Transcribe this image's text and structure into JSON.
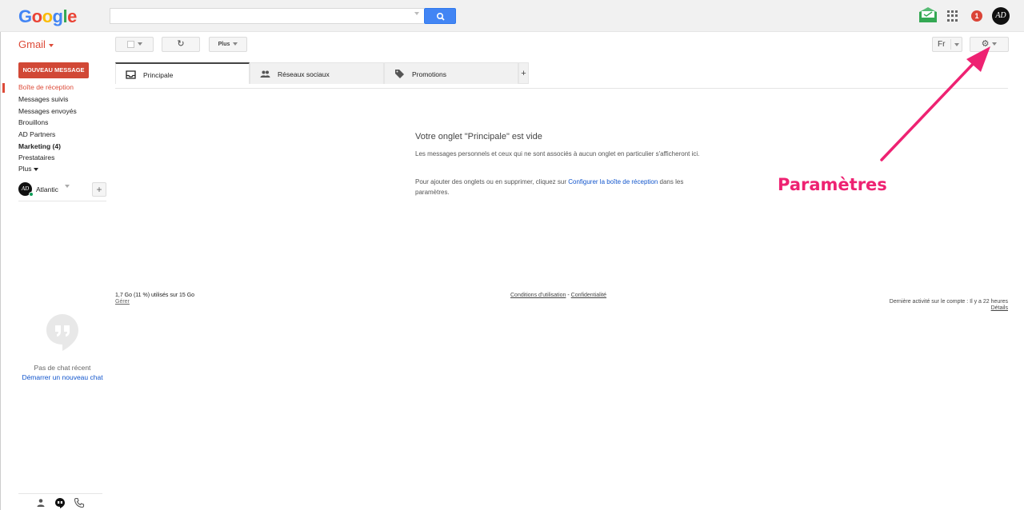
{
  "header": {
    "logo_letters": [
      {
        "ch": "G",
        "color": "#4285f4"
      },
      {
        "ch": "o",
        "color": "#ea4335"
      },
      {
        "ch": "o",
        "color": "#fbbc05"
      },
      {
        "ch": "g",
        "color": "#4285f4"
      },
      {
        "ch": "l",
        "color": "#34a853"
      },
      {
        "ch": "e",
        "color": "#ea4335"
      }
    ],
    "search_value": "",
    "notification_count": "1",
    "avatar_initials": "AD"
  },
  "toolbar": {
    "gmail_label": "Gmail",
    "refresh_glyph": "↻",
    "more_label": "Plus",
    "lang_label": "Fr",
    "settings_glyph": "⚙"
  },
  "sidebar": {
    "compose_label": "NOUVEAU MESSAGE",
    "items": [
      {
        "label": "Boîte de réception",
        "active": true,
        "bold": false
      },
      {
        "label": "Messages suivis",
        "active": false,
        "bold": false
      },
      {
        "label": "Messages envoyés",
        "active": false,
        "bold": false
      },
      {
        "label": "Brouillons",
        "active": false,
        "bold": false
      },
      {
        "label": "AD Partners",
        "active": false,
        "bold": false
      },
      {
        "label": "Marketing (4)",
        "active": false,
        "bold": true
      },
      {
        "label": "Prestataires",
        "active": false,
        "bold": false
      },
      {
        "label": "Plus",
        "active": false,
        "bold": false
      }
    ],
    "account_name": "Atlantic",
    "account_initials": "AD",
    "add_glyph": "+",
    "no_chat": "Pas de chat récent",
    "start_chat": "Démarrer un nouveau chat"
  },
  "tabs": [
    {
      "label": "Principale",
      "icon": "inbox-icon",
      "active": true
    },
    {
      "label": "Réseaux sociaux",
      "icon": "people-icon",
      "active": false
    },
    {
      "label": "Promotions",
      "icon": "tag-icon",
      "active": false
    }
  ],
  "tab_add_glyph": "+",
  "main": {
    "empty_title": "Votre onglet \"Principale\" est vide",
    "empty_desc": "Les messages personnels et ceux qui ne sont associés à aucun onglet en particulier s'afficheront ici.",
    "hint_before": "Pour ajouter des onglets ou en supprimer, cliquez sur ",
    "hint_link": "Configurer la boîte de réception",
    "hint_after": " dans les paramètres."
  },
  "footer": {
    "storage": "1,7 Go (11 %) utilisés sur 15 Go",
    "manage": "Gérer",
    "terms": "Conditions d'utilisation",
    "sep": " - ",
    "privacy": "Confidentialité",
    "last_activity": "Dernière activité sur le compte : Il y a 22 heures",
    "details": "Détails"
  },
  "annotation": {
    "label": "Paramètres",
    "color": "#ee2272"
  },
  "colors": {
    "gmail_red": "#dd4b39",
    "compose_bg": "#d14836",
    "search_blue": "#4285f4",
    "link_blue": "#1155cc"
  }
}
